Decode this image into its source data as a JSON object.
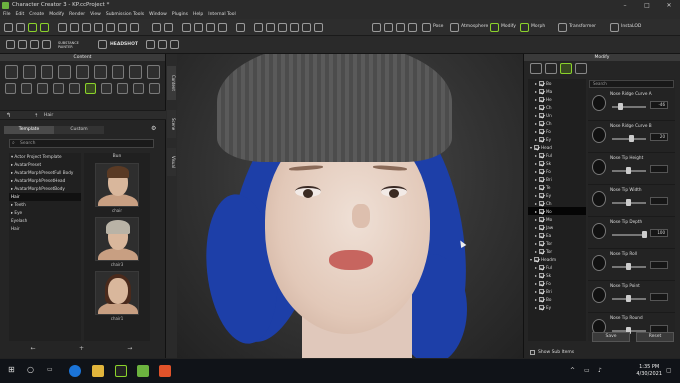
{
  "window": {
    "title": "Character Creator 3 - KP.ccProject *",
    "controls": [
      "–",
      "□",
      "✕"
    ]
  },
  "menu": [
    "File",
    "Edit",
    "Create",
    "Modify",
    "Render",
    "View",
    "Submission Tools",
    "Window",
    "Plugins",
    "Help",
    "Internal Tool"
  ],
  "toolbar": {
    "quality": "High",
    "pose": "Pose",
    "atmosphere": "Atmosphere",
    "modify": "Modify",
    "morph": "Morph",
    "transformer": "Transformer",
    "instaLOD": "InstaLOD",
    "substance": "SUBSTANCE\nPAINTER",
    "headshot": "HEADSHOT"
  },
  "content": {
    "header": "Content",
    "breadcrumb": "Hair",
    "tabs": [
      "Template",
      "Custom"
    ],
    "active_tab": "Template",
    "search_placeholder": "Search",
    "tree": [
      "▾ Actor Project Template",
      "  ▸ AvatarPreset",
      "  ▸ AvatarMorphPresetFull Body",
      "  ▸ AvatarMorphPresetHead",
      "  ▸ AvatarMorphPresetBody",
      "    Hair",
      "  ▸ Teeth",
      "  ▸ Eye",
      "    Eyelash",
      "    Hair"
    ],
    "tree_selected_index": 5,
    "thumb_header": "Bun",
    "thumbs": [
      "chair",
      "chair3",
      "chair1"
    ],
    "bottom_buttons": [
      "←",
      "+",
      "→"
    ]
  },
  "side_tabs": [
    "Content",
    "Scene",
    "Visual"
  ],
  "modify": {
    "header": "Modify",
    "search_placeholder": "Search",
    "list": [
      {
        "exp": "▸",
        "label": "Bo",
        "on": true
      },
      {
        "exp": "▸",
        "label": "Ma",
        "on": true
      },
      {
        "exp": "▸",
        "label": "He",
        "on": true
      },
      {
        "exp": "▸",
        "label": "Ch",
        "on": true
      },
      {
        "exp": "▸",
        "label": "Un",
        "on": true
      },
      {
        "exp": "▸",
        "label": "Ch",
        "on": true
      },
      {
        "exp": "▸",
        "label": "Fo",
        "on": true
      },
      {
        "exp": "▸",
        "label": "Ey",
        "on": true
      },
      {
        "exp": "▾",
        "label": "Head",
        "on": true,
        "group": true
      },
      {
        "exp": "▸",
        "label": "Ful",
        "on": true
      },
      {
        "exp": "▸",
        "label": "Sk",
        "on": true
      },
      {
        "exp": "▸",
        "label": "Fo",
        "on": true
      },
      {
        "exp": "▸",
        "label": "Bri",
        "on": true
      },
      {
        "exp": "▸",
        "label": "Te",
        "on": true
      },
      {
        "exp": "▸",
        "label": "Ey",
        "on": true
      },
      {
        "exp": "▸",
        "label": "Ch",
        "on": true
      },
      {
        "exp": "▸",
        "label": "No",
        "on": true,
        "sel": true
      },
      {
        "exp": "▸",
        "label": "Mo",
        "on": true
      },
      {
        "exp": "▸",
        "label": "Jaw",
        "on": true
      },
      {
        "exp": "▸",
        "label": "Ea",
        "on": true
      },
      {
        "exp": "▸",
        "label": "Tor",
        "on": true
      },
      {
        "exp": "▸",
        "label": "Tor",
        "on": true
      },
      {
        "exp": "▾",
        "label": "Headm",
        "on": true,
        "group": true
      },
      {
        "exp": "▸",
        "label": "Ful",
        "on": true
      },
      {
        "exp": "▸",
        "label": "Sk",
        "on": true
      },
      {
        "exp": "▸",
        "label": "Fo",
        "on": true
      },
      {
        "exp": "▸",
        "label": "Bri",
        "on": true
      },
      {
        "exp": "▸",
        "label": "Bo",
        "on": true
      },
      {
        "exp": "▸",
        "label": "Ey",
        "on": true
      }
    ],
    "sliders": [
      {
        "label": "Nose Ridge Curve A",
        "value": "-46",
        "pos": 0.25
      },
      {
        "label": "Nose Ridge Curve B",
        "value": "20",
        "pos": 0.6
      },
      {
        "label": "Nose Tip Height",
        "value": "",
        "pos": 0.5
      },
      {
        "label": "Nose Tip Width",
        "value": "",
        "pos": 0.5
      },
      {
        "label": "Nose Tip Depth",
        "value": "100",
        "pos": 1.0
      },
      {
        "label": "Nose Tip Roll",
        "value": "",
        "pos": 0.5
      },
      {
        "label": "Nose Tip Point",
        "value": "",
        "pos": 0.5
      },
      {
        "label": "Nose Tip Round",
        "value": "",
        "pos": 0.5
      }
    ],
    "buttons": {
      "save": "Save",
      "reset": "Reset"
    },
    "show_sub": "Show Sub Items"
  },
  "taskbar": {
    "time": "1:35 PM",
    "date": "4/30/2021"
  },
  "colors": {
    "accent": "#8bd32b",
    "hair": "#1d3fa8"
  }
}
